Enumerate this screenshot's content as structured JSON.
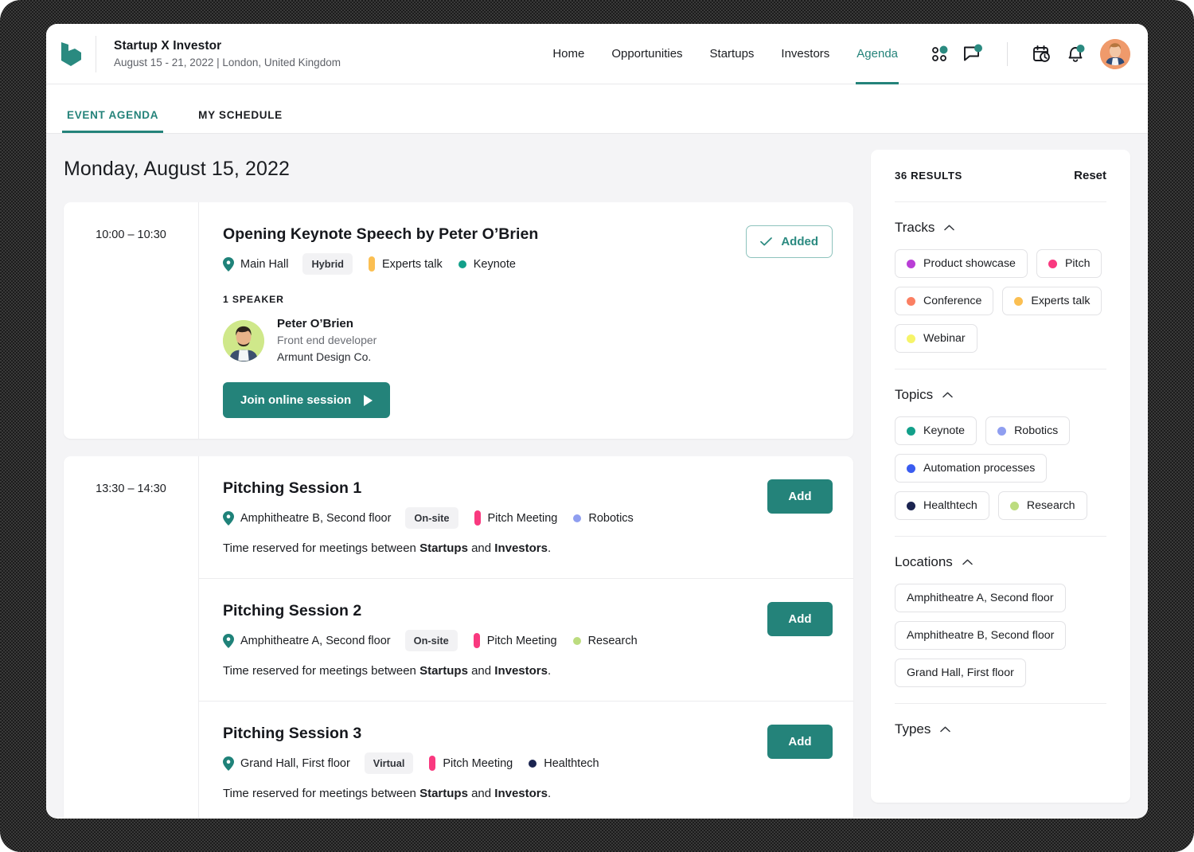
{
  "header": {
    "logo_icon": "brand-logo-icon",
    "brand_title": "Startup X Investor",
    "brand_subtitle": "August 15 - 21, 2022 | London, United Kingdom",
    "nav_links": [
      {
        "label": "Home",
        "active": false
      },
      {
        "label": "Opportunities",
        "active": false
      },
      {
        "label": "Startups",
        "active": false
      },
      {
        "label": "Investors",
        "active": false
      },
      {
        "label": "Agenda",
        "active": true
      }
    ],
    "icons": [
      {
        "name": "apps-grid-icon",
        "badge": true
      },
      {
        "name": "chat-bubble-icon",
        "badge": true
      },
      {
        "name": "calendar-clock-icon",
        "badge": false
      },
      {
        "name": "bell-notification-icon",
        "badge": true
      }
    ],
    "avatar_name": "user-avatar",
    "badge_color": "#2a8a80"
  },
  "subtabs": [
    {
      "label": "EVENT AGENDA",
      "active": true
    },
    {
      "label": "MY SCHEDULE",
      "active": false
    }
  ],
  "agenda": {
    "day_title": "Monday, August 15, 2022",
    "blocks": [
      {
        "time": "10:00 – 10:30",
        "sessions": [
          {
            "title": "Opening Keynote Speech by Peter O’Brien",
            "location": "Main Hall",
            "mode": "Hybrid",
            "track": {
              "label": "Experts talk",
              "color": "#fbbf52"
            },
            "topic": {
              "label": "Keynote",
              "color": "#12a08a"
            },
            "speakers_label": "1 SPEAKER",
            "speaker": {
              "name": "Peter O’Brien",
              "role": "Front end developer",
              "org": "Armunt Design Co."
            },
            "join_label": "Join online session",
            "action": {
              "type": "added",
              "label": "Added"
            }
          }
        ]
      },
      {
        "time": "13:30 – 14:30",
        "sessions": [
          {
            "title": "Pitching Session 1",
            "location": "Amphitheatre B, Second floor",
            "mode": "On-site",
            "track": {
              "label": "Pitch Meeting",
              "color": "#f9397f"
            },
            "topic": {
              "label": "Robotics",
              "color": "#8f9ef0"
            },
            "description_pre": "Time reserved for meetings between ",
            "description_b1": "Startups",
            "description_mid": " and ",
            "description_b2": "Investors",
            "description_post": ".",
            "action": {
              "type": "add",
              "label": "Add"
            }
          },
          {
            "title": "Pitching Session 2",
            "location": "Amphitheatre A, Second floor",
            "mode": "On-site",
            "track": {
              "label": "Pitch Meeting",
              "color": "#f9397f"
            },
            "topic": {
              "label": "Research",
              "color": "#bcdc7f"
            },
            "description_pre": "Time reserved for meetings between ",
            "description_b1": "Startups",
            "description_mid": " and ",
            "description_b2": "Investors",
            "description_post": ".",
            "action": {
              "type": "add",
              "label": "Add"
            }
          },
          {
            "title": "Pitching Session 3",
            "location": "Grand Hall, First floor",
            "mode": "Virtual",
            "track": {
              "label": "Pitch Meeting",
              "color": "#f9397f"
            },
            "topic": {
              "label": "Healthtech",
              "color": "#1b2450"
            },
            "description_pre": "Time reserved for meetings between ",
            "description_b1": "Startups",
            "description_mid": " and ",
            "description_b2": "Investors",
            "description_post": ".",
            "action": {
              "type": "add",
              "label": "Add"
            }
          }
        ]
      }
    ]
  },
  "filters": {
    "results_label": "36 RESULTS",
    "reset_label": "Reset",
    "groups": [
      {
        "title": "Tracks",
        "expanded": true,
        "options": [
          {
            "label": "Product showcase",
            "color": "#b93ed6"
          },
          {
            "label": "Pitch",
            "color": "#f9397f"
          },
          {
            "label": "Conference",
            "color": "#fb7f62"
          },
          {
            "label": "Experts talk",
            "color": "#fbbf52"
          },
          {
            "label": "Webinar",
            "color": "#f6f469"
          }
        ]
      },
      {
        "title": "Topics",
        "expanded": true,
        "options": [
          {
            "label": "Keynote",
            "color": "#12a08a"
          },
          {
            "label": "Robotics",
            "color": "#8f9ef0"
          },
          {
            "label": "Automation processes",
            "color": "#3a5cf0"
          },
          {
            "label": "Healthtech",
            "color": "#1b2450"
          },
          {
            "label": "Research",
            "color": "#bcdc7f"
          }
        ]
      },
      {
        "title": "Locations",
        "expanded": true,
        "options": [
          {
            "label": "Amphitheatre A, Second floor",
            "color": null
          },
          {
            "label": "Amphitheatre B, Second floor",
            "color": null
          },
          {
            "label": "Grand Hall, First floor",
            "color": null
          }
        ]
      },
      {
        "title": "Types",
        "expanded": true,
        "options": []
      }
    ]
  },
  "theme": {
    "accent": "#24837a",
    "page_bg": "#f4f4f6",
    "card_bg": "#ffffff",
    "text": "#1b1d21"
  }
}
